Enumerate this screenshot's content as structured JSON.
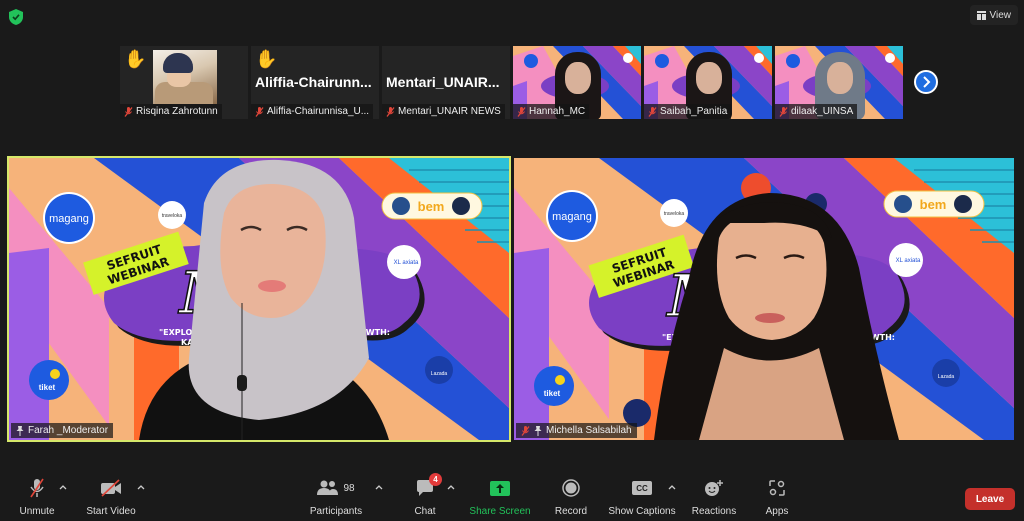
{
  "top_bar": {
    "security_icon": "shield-check-icon",
    "security_color": "#22c25a",
    "view_label": "View",
    "view_icon": "grid-icon"
  },
  "thumbnail_strip": {
    "participants": [
      {
        "name": "Risqina Zahrotunn",
        "hand_raised": true,
        "muted": true,
        "display": "photo"
      },
      {
        "name": "Aliffia-Chairunnisa_U...",
        "display_name": "Aliffia-Chairunn...",
        "hand_raised": true,
        "muted": true,
        "display": "name"
      },
      {
        "name": "Mentari_UNAIR NEWS",
        "display_name": "Mentari_UNAIR...",
        "hand_raised": false,
        "muted": true,
        "display": "name"
      },
      {
        "name": "Hannah_MC",
        "hand_raised": false,
        "muted": true,
        "display": "video"
      },
      {
        "name": "Saibah_Panitia",
        "hand_raised": false,
        "muted": true,
        "display": "video"
      },
      {
        "name": "dilaak_UINSA",
        "hand_raised": false,
        "muted": true,
        "display": "video"
      }
    ],
    "next_page_icon": "chevron-right-icon"
  },
  "main_tiles": [
    {
      "name": "Farah _Moderator",
      "pinned": true,
      "muted": false,
      "active_speaker": true,
      "active_border_color": "#d6e86a"
    },
    {
      "name": "Michella Salsabilah",
      "pinned": true,
      "muted": true,
      "active_speaker": false
    }
  ],
  "slide": {
    "badge_line1": "SEFRUIT",
    "badge_line2": "WEBINAR",
    "script_title": "Melia",
    "subtitle_left_1": "\"EXPLORI",
    "subtitle_right_1": "OWTH:",
    "subtitle_left_2": "KA",
    "logos": {
      "magang": "magang",
      "traveloka": "traveloka",
      "bem": "bem",
      "xl": "XL axiata",
      "tiket": "tiket",
      "lazada": "Lazada"
    }
  },
  "toolbar": {
    "unmute_label": "Unmute",
    "start_video_label": "Start Video",
    "participants_label": "Participants",
    "participants_count": "98",
    "chat_label": "Chat",
    "chat_badge": "4",
    "share_screen_label": "Share Screen",
    "share_screen_color": "#22c25a",
    "record_label": "Record",
    "captions_label": "Show Captions",
    "captions_icon_text": "CC",
    "reactions_label": "Reactions",
    "apps_label": "Apps",
    "leave_label": "Leave",
    "leave_color": "#c4302b"
  }
}
